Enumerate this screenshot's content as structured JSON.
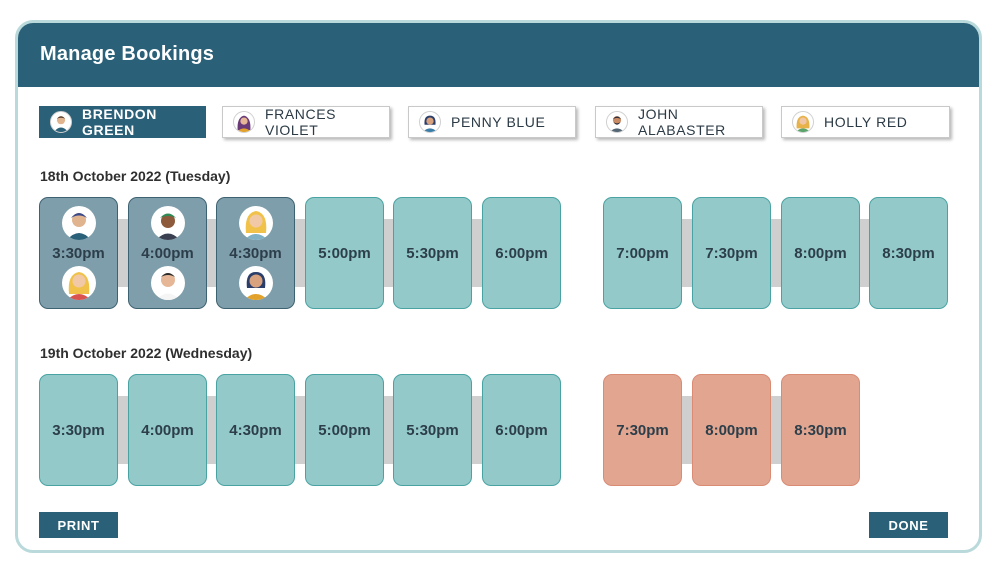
{
  "window": {
    "title": "Manage Bookings"
  },
  "staff_tabs": [
    {
      "name": "BRENDON GREEN",
      "avatar_icon": "person-avatar-icon",
      "selected": true
    },
    {
      "name": "FRANCES VIOLET",
      "avatar_icon": "person-avatar-icon",
      "selected": false
    },
    {
      "name": "PENNY BLUE",
      "avatar_icon": "person-avatar-icon",
      "selected": false
    },
    {
      "name": "JOHN ALABASTER",
      "avatar_icon": "person-avatar-icon",
      "selected": false
    },
    {
      "name": "HOLLY RED",
      "avatar_icon": "person-avatar-icon",
      "selected": false
    }
  ],
  "days": [
    {
      "date_label": "18th October 2022 (Tuesday)",
      "slots": [
        {
          "time": "3:30pm",
          "status": "booked",
          "faces": [
            "guest-avatar-icon",
            "guest-avatar-icon"
          ]
        },
        {
          "time": "4:00pm",
          "status": "booked",
          "faces": [
            "guest-avatar-icon",
            "guest-avatar-icon"
          ]
        },
        {
          "time": "4:30pm",
          "status": "booked",
          "faces": [
            "guest-avatar-icon",
            "guest-avatar-icon"
          ]
        },
        {
          "time": "5:00pm",
          "status": "available"
        },
        {
          "time": "5:30pm",
          "status": "available"
        },
        {
          "time": "6:00pm",
          "status": "available"
        },
        {
          "time": "7:00pm",
          "status": "available"
        },
        {
          "time": "7:30pm",
          "status": "available"
        },
        {
          "time": "8:00pm",
          "status": "available"
        },
        {
          "time": "8:30pm",
          "status": "available"
        }
      ]
    },
    {
      "date_label": "19th October 2022 (Wednesday)",
      "slots": [
        {
          "time": "3:30pm",
          "status": "available"
        },
        {
          "time": "4:00pm",
          "status": "available"
        },
        {
          "time": "4:30pm",
          "status": "available"
        },
        {
          "time": "5:00pm",
          "status": "available"
        },
        {
          "time": "5:30pm",
          "status": "available"
        },
        {
          "time": "6:00pm",
          "status": "available"
        },
        {
          "time": "7:30pm",
          "status": "unavailable"
        },
        {
          "time": "8:00pm",
          "status": "unavailable"
        },
        {
          "time": "8:30pm",
          "status": "unavailable"
        }
      ]
    }
  ],
  "actions": {
    "print_label": "PRINT",
    "done_label": "DONE"
  },
  "colors": {
    "header": "#2b6178",
    "available": "#93c9c9",
    "booked": "#7f9eab",
    "unavailable": "#e1a590",
    "connector": "#cfcfcf"
  }
}
